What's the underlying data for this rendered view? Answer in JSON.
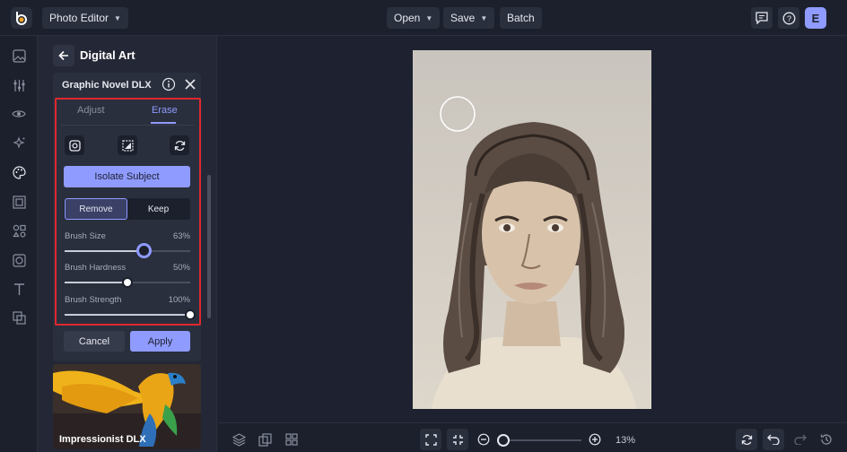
{
  "topbar": {
    "app_menu": "Photo Editor",
    "open": "Open",
    "save": "Save",
    "batch": "Batch",
    "avatar_initial": "E"
  },
  "panel": {
    "title": "Digital Art",
    "card_title": "Graphic Novel DLX",
    "tabs": [
      {
        "label": "Adjust",
        "active": false
      },
      {
        "label": "Erase",
        "active": true
      }
    ],
    "isolate_button": "Isolate Subject",
    "mode": [
      {
        "label": "Remove",
        "active": true
      },
      {
        "label": "Keep",
        "active": false
      }
    ],
    "sliders": [
      {
        "label": "Brush Size",
        "value_text": "63%",
        "value": 0.63
      },
      {
        "label": "Brush Hardness",
        "value_text": "50%",
        "value": 0.5
      },
      {
        "label": "Brush Strength",
        "value_text": "100%",
        "value": 1.0
      }
    ],
    "cancel": "Cancel",
    "apply": "Apply",
    "next_effect": "Impressionist DLX"
  },
  "bottombar": {
    "zoom_label": "13%",
    "zoom_value": 0.13
  },
  "colors": {
    "accent": "#8f9bff",
    "highlight_border": "#e0282f",
    "background": "#1e2230"
  }
}
